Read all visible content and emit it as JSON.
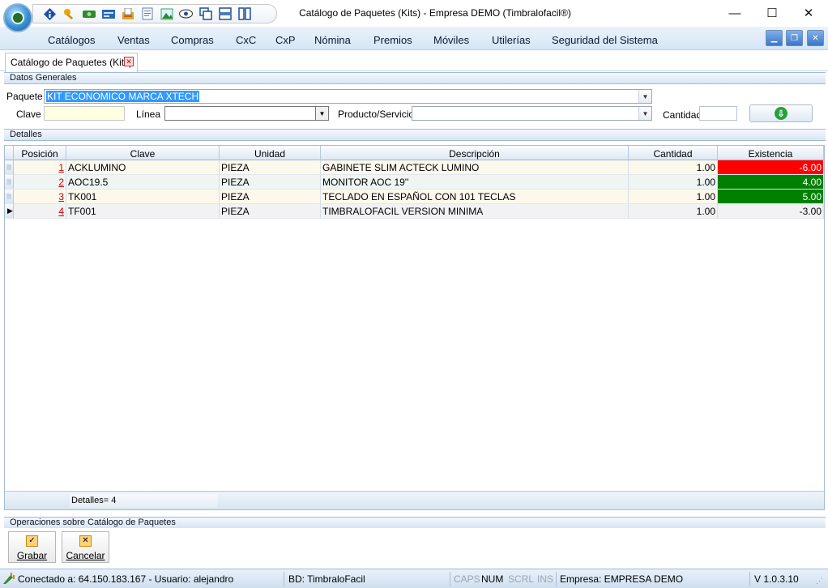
{
  "window": {
    "title": "Catálogo de Paquetes (Kits) - Empresa DEMO (Timbralofacil®)",
    "minimize_glyph": "—",
    "maximize_glyph": "☐",
    "close_glyph": "✕"
  },
  "quick_access": [
    {
      "icon": "info-icon"
    },
    {
      "icon": "key-icon"
    },
    {
      "icon": "money-icon"
    },
    {
      "icon": "card-icon"
    },
    {
      "icon": "inbox-icon"
    },
    {
      "icon": "document-icon"
    },
    {
      "icon": "image-icon"
    },
    {
      "icon": "eye-icon"
    },
    {
      "icon": "cascade-windows-icon"
    },
    {
      "icon": "tile-horizontal-icon"
    },
    {
      "icon": "tile-vertical-icon"
    }
  ],
  "menu": {
    "items": [
      "Catálogos",
      "Ventas",
      "Compras",
      "CxC",
      "CxP",
      "Nómina",
      "Premios",
      "Móviles",
      "Utilerías",
      "Seguridad del Sistema"
    ]
  },
  "tab": {
    "label": "Catálogo de Paquetes (Kits)"
  },
  "datos_generales": {
    "section_title": "Datos Generales",
    "paquete_label": "Paquete",
    "paquete_value": "KIT ECONOMICO MARCA XTECH",
    "clave_label": "Clave",
    "clave_value": "",
    "linea_label": "Línea",
    "linea_value": "",
    "producto_label": "Producto/Servicio",
    "producto_value": "",
    "cantidad_label": "Cantidad",
    "cantidad_value": ""
  },
  "detalles": {
    "section_title": "Detalles",
    "columns": [
      "Posición",
      "Clave",
      "Unidad",
      "Descripción",
      "Cantidad",
      "Existencia"
    ],
    "rows": [
      {
        "posicion": "1",
        "clave": "ACKLUMINO",
        "unidad": "PIEZA",
        "descripcion": "GABINETE SLIM ACTECK LUMINO",
        "cantidad": "1.00",
        "existencia": "-6.00",
        "status": "negative"
      },
      {
        "posicion": "2",
        "clave": "AOC19.5",
        "unidad": "PIEZA",
        "descripcion": "MONITOR AOC 19''",
        "cantidad": "1.00",
        "existencia": "4.00",
        "status": "positive"
      },
      {
        "posicion": "3",
        "clave": "TK001",
        "unidad": "PIEZA",
        "descripcion": "TECLADO EN ESPAÑOL CON 101 TECLAS",
        "cantidad": "1.00",
        "existencia": "5.00",
        "status": "positive"
      },
      {
        "posicion": "4",
        "clave": "TF001",
        "unidad": "PIEZA",
        "descripcion": "TIMBRALOFACIL VERSION MINIMA",
        "cantidad": "1.00",
        "existencia": "-3.00",
        "status": "neutral"
      }
    ],
    "footer_count": "Detalles= 4"
  },
  "operaciones": {
    "section_title": "Operaciones sobre Catálogo de Paquetes",
    "grabar_label": "Grabar",
    "cancelar_label": "Cancelar"
  },
  "statusbar": {
    "connection": "Conectado a: 64.150.183.167 - Usuario: alejandro",
    "database": "BD: TimbraloFacil",
    "caps": "CAPS",
    "num": "NUM",
    "scrl": "SCRL",
    "ins": "INS",
    "empresa": "Empresa: EMPRESA DEMO",
    "version": "V 1.0.3.10"
  },
  "colors": {
    "negative_stock": "#ff0000",
    "positive_stock": "#008000",
    "row_even": "#fdf8ec",
    "row_odd": "#eef5f3",
    "row_current": "#f2f2f2",
    "selection": "#3399ff"
  }
}
